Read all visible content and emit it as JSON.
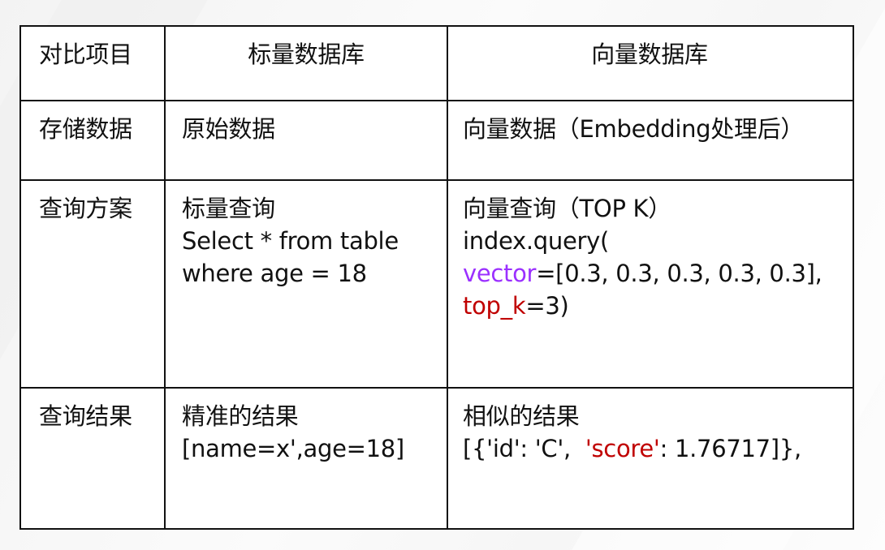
{
  "table": {
    "header": {
      "item": "对比项目",
      "scalar": "标量数据库",
      "vector": "向量数据库"
    },
    "rows": [
      {
        "item": "存储数据",
        "scalar_lines": [
          "原始数据"
        ],
        "vector_lines": [
          "向量数据（Embedding处理后）"
        ]
      },
      {
        "item": "查询方案",
        "scalar_lines": [
          "标量查询",
          "Select * from table",
          "where age = 18"
        ],
        "vector_title": "向量查询（TOP K）",
        "vector_call": "index.query(",
        "vector_param_name": "vector",
        "vector_param_value": "=[0.3, 0.3, 0.3, 0.3, 0.3],",
        "topk_param_name": "top_k",
        "topk_param_value": "=3)"
      },
      {
        "item": "查询结果",
        "scalar_lines": [
          "精准的结果",
          "[name=x',age=18]"
        ],
        "vector_title": "相似的结果",
        "result_prefix": "[{'id': 'C',  ",
        "result_key": "'score'",
        "result_suffix": ": 1.76717]},"
      }
    ]
  },
  "colors": {
    "highlight_purple": "#9b30ff",
    "highlight_red": "#c00000"
  }
}
